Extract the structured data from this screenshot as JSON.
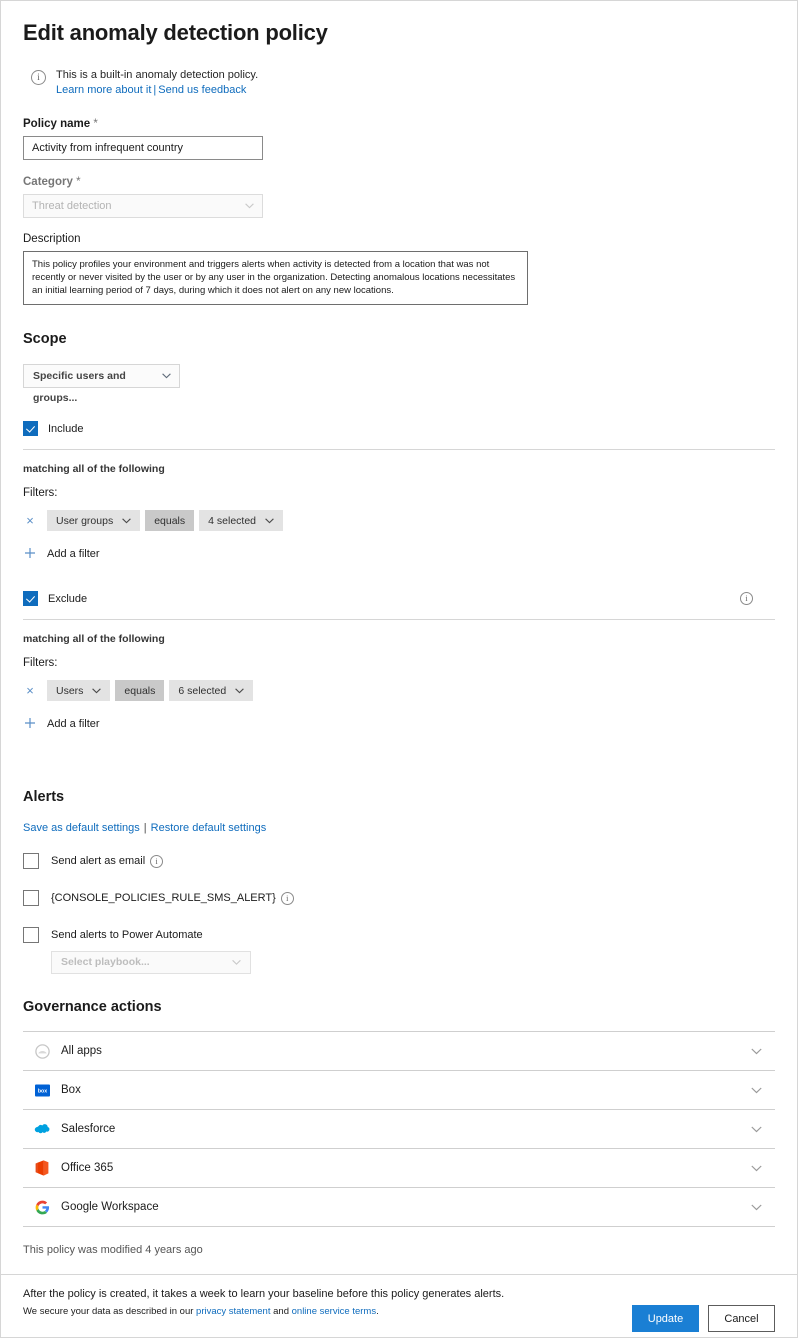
{
  "header": {
    "title": "Edit anomaly detection policy"
  },
  "banner": {
    "icon": "info-icon",
    "text": "This is a built-in anomaly detection policy.",
    "learn_more": "Learn more about it",
    "separator": "|",
    "feedback": "Send us feedback"
  },
  "policy_name": {
    "label": "Policy name",
    "required_mark": "*",
    "value": "Activity from infrequent country"
  },
  "category": {
    "label": "Category",
    "required_mark": "*",
    "value": "Threat detection",
    "chevron": "chevron-down-icon"
  },
  "description": {
    "label": "Description",
    "value": "This policy profiles your environment and triggers alerts when activity is detected from a location that was not recently or never visited by the user or by any user in the organization. Detecting anomalous locations necessitates an initial learning period of 7 days, during which it does not alert on any new locations."
  },
  "scope": {
    "heading": "Scope",
    "selector_value": "Specific users and groups...",
    "include": {
      "label": "Include",
      "checked": true,
      "matching_text": "matching all of the following",
      "filters_label": "Filters:",
      "filter": {
        "remove": "×",
        "field": "User groups",
        "operator": "equals",
        "value": "4 selected"
      },
      "add_filter": "Add a filter",
      "add_icon": "plus-icon"
    },
    "exclude": {
      "label": "Exclude",
      "checked": true,
      "info_icon": "info-icon",
      "matching_text": "matching all of the following",
      "filters_label": "Filters:",
      "filter": {
        "remove": "×",
        "field": "Users",
        "operator": "equals",
        "value": "6 selected"
      },
      "add_filter": "Add a filter",
      "add_icon": "plus-icon"
    }
  },
  "alerts": {
    "heading": "Alerts",
    "save_default": "Save as default settings",
    "separator": "|",
    "restore_default": "Restore default settings",
    "options": [
      {
        "label": "Send alert as email",
        "checked": false,
        "has_info": true
      },
      {
        "label": "{CONSOLE_POLICIES_RULE_SMS_ALERT}",
        "checked": false,
        "has_info": true
      },
      {
        "label": "Send alerts to Power Automate",
        "checked": false,
        "has_info": false
      }
    ],
    "playbook_placeholder": "Select playbook..."
  },
  "governance": {
    "heading": "Governance actions",
    "rows": [
      {
        "label": "All apps",
        "icon": "all-apps-icon"
      },
      {
        "label": "Box",
        "icon": "box-icon"
      },
      {
        "label": "Salesforce",
        "icon": "salesforce-icon"
      },
      {
        "label": "Office 365",
        "icon": "office365-icon"
      },
      {
        "label": "Google Workspace",
        "icon": "google-workspace-icon"
      }
    ]
  },
  "footer": {
    "modified": "This policy was modified 4 years ago",
    "note_line1": "After the policy is created, it takes a week to learn your baseline before this policy generates alerts.",
    "note_line2_pre": "We secure your data as described in our ",
    "privacy_link": "privacy statement",
    "note_line2_mid": " and ",
    "terms_link": "online service terms",
    "note_line2_post": ".",
    "update_button": "Update",
    "cancel_button": "Cancel"
  },
  "colors": {
    "accent": "#0f6cbd",
    "primary_button": "#1a7fd4",
    "link": "#0f6cbd",
    "pill": "#e3e3e3",
    "pill_operator": "#c9c9c9"
  }
}
